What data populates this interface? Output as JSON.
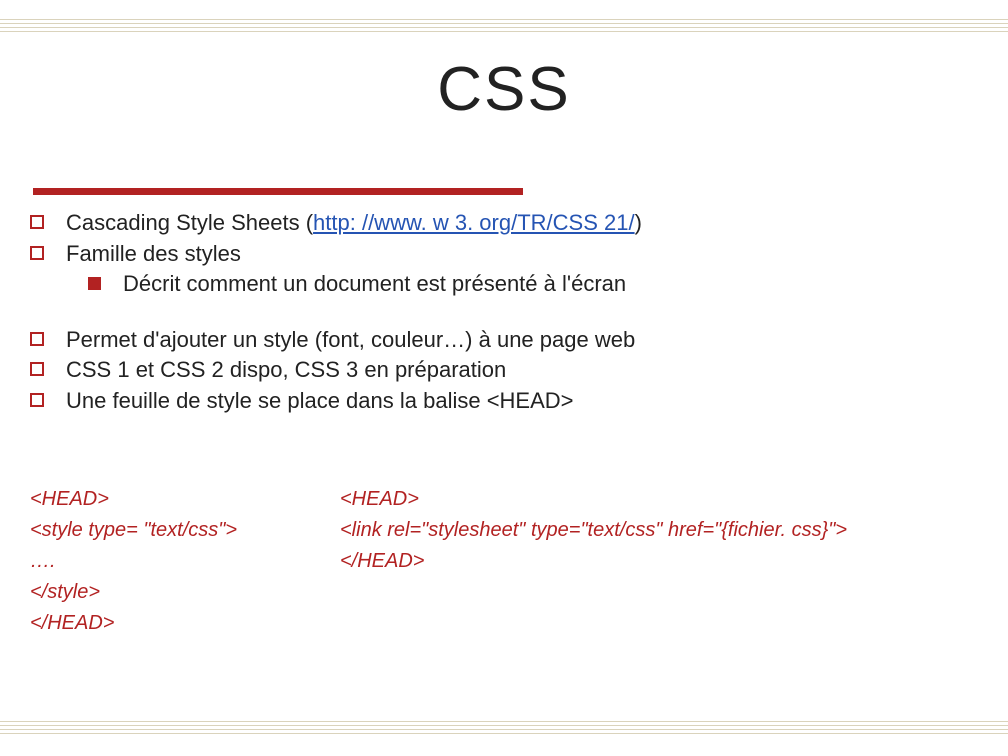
{
  "title": "CSS",
  "bullets": {
    "b1_prefix": "Cascading Style Sheets (",
    "b1_link": "http: //www. w 3. org/TR/CSS 21/",
    "b1_suffix": ")",
    "b2": "Famille des styles",
    "b2_sub": "Décrit comment un document est présenté à l'écran",
    "b3": "Permet d'ajouter un style (font, couleur…) à une page web",
    "b4": "CSS 1 et CSS 2 dispo, CSS 3 en préparation",
    "b5": "Une feuille de style se place dans la balise <HEAD>"
  },
  "codeLeft": {
    "l1": "<HEAD>",
    "l2": "<style type= \"text/css\">",
    "l3": "….",
    "l4": "</style>",
    "l5": "</HEAD>"
  },
  "codeRight": {
    "l1": "<HEAD>",
    "l2": "<link rel=\"stylesheet\" type=\"text/css\" href=\"{fichier. css}\">",
    "l3": "</HEAD>"
  }
}
